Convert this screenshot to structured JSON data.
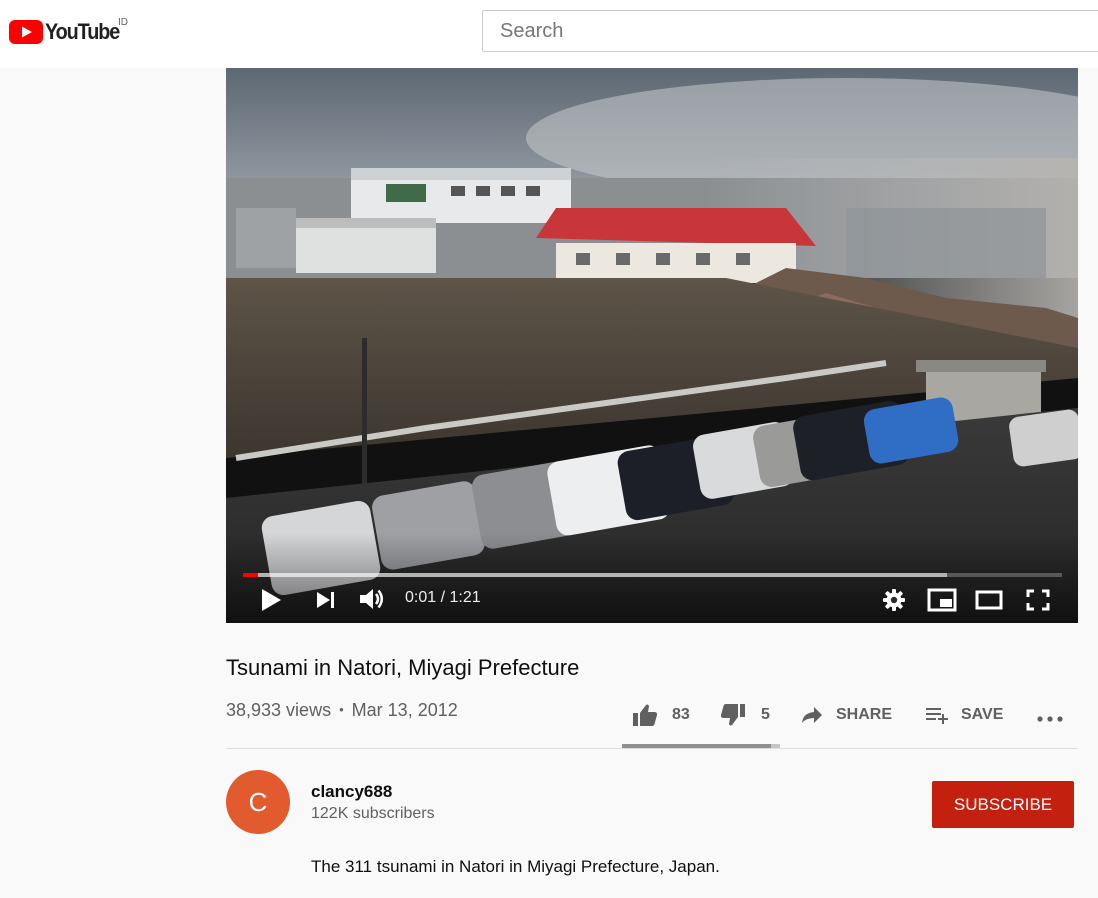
{
  "header": {
    "logo_text": "YouTube",
    "country_code": "ID",
    "search_placeholder": "Search"
  },
  "player": {
    "current_time": "0:01",
    "separator": " / ",
    "duration": "1:21",
    "progress_played_fraction": 0.018,
    "progress_loaded_fraction": 0.86
  },
  "video": {
    "title": "Tsunami in Natori, Miyagi Prefecture",
    "views": "38,933 views",
    "dot": "•",
    "date": "Mar 13, 2012",
    "likes": "83",
    "dislikes": "5",
    "share_label": "SHARE",
    "save_label": "SAVE",
    "like_ratio": 0.94
  },
  "channel": {
    "avatar_letter": "C",
    "name": "clancy688",
    "subscribers": "122K subscribers",
    "subscribe_label": "SUBSCRIBE",
    "description": "The 311 tsunami in Natori in Miyagi Prefecture, Japan."
  },
  "colors": {
    "brand_red": "#ff0000",
    "subscribe_red": "#c4200f",
    "avatar": "#e25b2e"
  },
  "icons": [
    "youtube-logo-icon",
    "play-icon",
    "next-icon",
    "volume-icon",
    "settings-icon",
    "miniplayer-icon",
    "theater-icon",
    "fullscreen-icon",
    "thumb-up-icon",
    "thumb-down-icon",
    "share-icon",
    "save-playlist-icon",
    "more-icon"
  ]
}
